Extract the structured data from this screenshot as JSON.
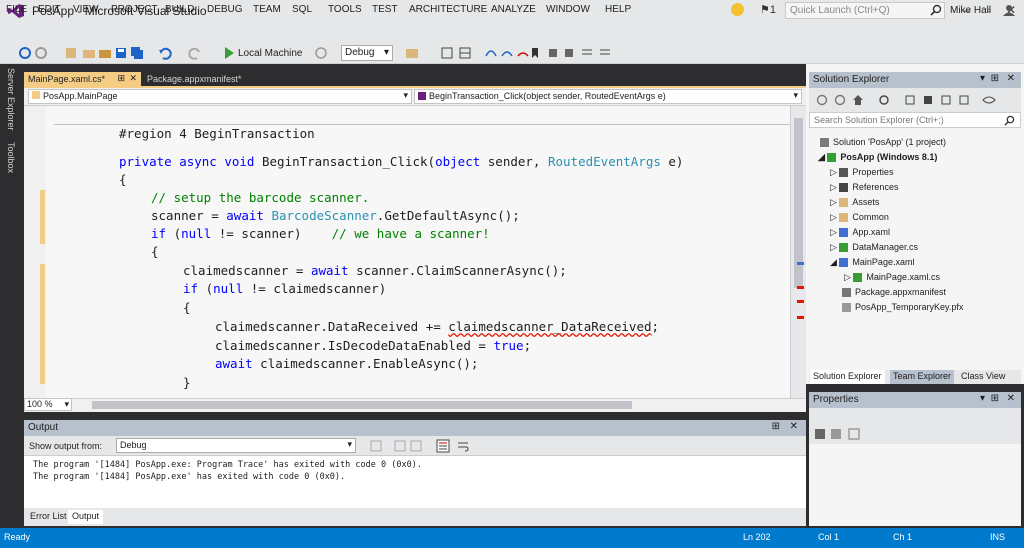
{
  "window": {
    "title": "PosApp - Microsoft Visual Studio",
    "quick_launch_placeholder": "Quick Launch (Ctrl+Q)",
    "notification_count": "1",
    "user": "Mike Hall"
  },
  "menu": [
    "FILE",
    "EDIT",
    "VIEW",
    "PROJECT",
    "BUILD",
    "DEBUG",
    "TEAM",
    "SQL",
    "TOOLS",
    "TEST",
    "ARCHITECTURE",
    "ANALYZE",
    "WINDOW",
    "HELP"
  ],
  "toolbar": {
    "run_target": "Local Machine",
    "configuration": "Debug"
  },
  "side_tabs": [
    "Server Explorer",
    "Toolbox"
  ],
  "editor": {
    "tabs": [
      {
        "label": "MainPage.xaml.cs*",
        "active": true
      },
      {
        "label": "Package.appxmanifest*",
        "active": false
      }
    ],
    "nav_class": "PosApp.MainPage",
    "nav_member": "BeginTransaction_Click(object sender, RoutedEventArgs e)",
    "zoom": "100 %",
    "code_lines": [
      "#region 4 BeginTransaction",
      "private async void BeginTransaction_Click(object sender, RoutedEventArgs e)",
      "{",
      "// setup the barcode scanner.",
      "scanner = await BarcodeScanner.GetDefaultAsync();",
      "if (null != scanner)    // we have a scanner!",
      "{",
      "claimedscanner = await scanner.ClaimScannerAsync();",
      "if (null != claimedscanner)",
      "{",
      "claimedscanner.DataReceived += claimedscanner_DataReceived;",
      "claimedscanner.IsDecodeDataEnabled = true;",
      "await claimedscanner.EnableAsync();",
      "}"
    ]
  },
  "output": {
    "title": "Output",
    "show_output_from_label": "Show output from:",
    "source": "Debug",
    "lines": [
      "The program '[1484] PosApp.exe: Program Trace' has exited with code 0 (0x0).",
      "The program '[1484] PosApp.exe' has exited with code 0 (0x0)."
    ],
    "bottom_tabs": [
      "Error List",
      "Output"
    ]
  },
  "solution_explorer": {
    "title": "Solution Explorer",
    "search_placeholder": "Search Solution Explorer (Ctrl+;)",
    "tree": [
      {
        "label": "Solution 'PosApp' (1 project)",
        "level": 0,
        "icon": "solution-icon"
      },
      {
        "label": "PosApp (Windows 8.1)",
        "level": 1,
        "icon": "csharp-project-icon",
        "bold": true
      },
      {
        "label": "Properties",
        "level": 2,
        "icon": "wrench-icon"
      },
      {
        "label": "References",
        "level": 2,
        "icon": "references-icon"
      },
      {
        "label": "Assets",
        "level": 2,
        "icon": "folder-icon"
      },
      {
        "label": "Common",
        "level": 2,
        "icon": "folder-icon"
      },
      {
        "label": "App.xaml",
        "level": 2,
        "icon": "xaml-file-icon"
      },
      {
        "label": "DataManager.cs",
        "level": 2,
        "icon": "csharp-file-icon"
      },
      {
        "label": "MainPage.xaml",
        "level": 2,
        "icon": "xaml-file-icon"
      },
      {
        "label": "MainPage.xaml.cs",
        "level": 3,
        "icon": "csharp-file-icon"
      },
      {
        "label": "Package.appxmanifest",
        "level": 2,
        "icon": "manifest-icon"
      },
      {
        "label": "PosApp_TemporaryKey.pfx",
        "level": 2,
        "icon": "key-file-icon"
      }
    ],
    "tabs": [
      "Solution Explorer",
      "Team Explorer",
      "Class View"
    ]
  },
  "properties": {
    "title": "Properties"
  },
  "status_bar": {
    "state": "Ready",
    "line": "Ln 202",
    "col": "Col 1",
    "ch": "Ch 1",
    "mode": "INS"
  },
  "colors": {
    "accent": "#007acc",
    "active_tab": "#f5cc84",
    "panel_title": "#b7c0cd",
    "keyword": "#0000ff",
    "type": "#2b91af",
    "comment": "#008000"
  }
}
